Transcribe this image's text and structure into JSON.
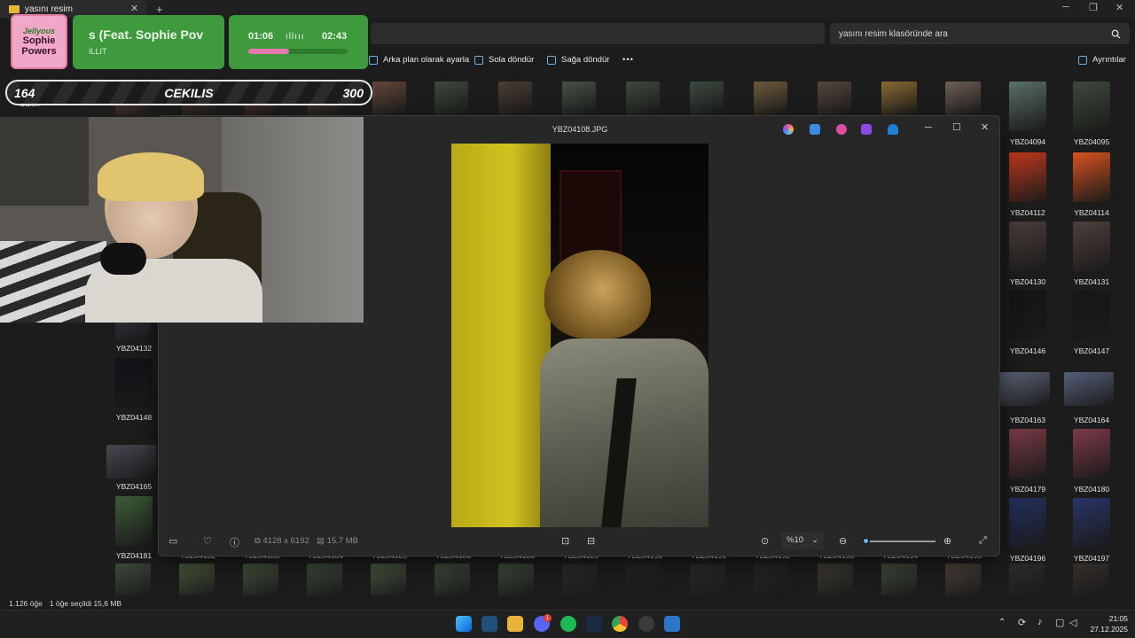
{
  "window": {
    "tab_title": "yasını resim",
    "new_tab": "+",
    "close_tab": "✕"
  },
  "search": {
    "placeholder": "yasını resim klasöründe ara"
  },
  "commands": {
    "set_background": "Arka plan olarak ayarla",
    "rotate_left": "Sola döndür",
    "rotate_right": "Sağa döndür",
    "more": "•••",
    "details": "Ayrıntılar"
  },
  "sidebar": {
    "gallery": "Galeri"
  },
  "files": {
    "right_col": [
      {
        "name": "YBZ04094",
        "color": "#5a6f6a"
      },
      {
        "name": "YBZ04095",
        "color": "#3c4a3a"
      },
      {
        "name": "YBZ04112",
        "color": "#c2391d"
      },
      {
        "name": "YBZ04114",
        "color": "#d8521f"
      },
      {
        "name": "YBZ04130",
        "color": "#4a3d3a"
      },
      {
        "name": "YBZ04131",
        "color": "#4d403c"
      },
      {
        "name": "YBZ04146",
        "color": "#141414"
      },
      {
        "name": "YBZ04147",
        "color": "#171717"
      },
      {
        "name": "YBZ04163",
        "color": "#5d6478"
      },
      {
        "name": "YBZ04164",
        "color": "#56607a"
      },
      {
        "name": "YBZ04179",
        "color": "#7a3b46"
      },
      {
        "name": "YBZ04180",
        "color": "#7e3a48"
      },
      {
        "name": "YBZ04196",
        "color": "#23305e"
      },
      {
        "name": "YBZ04197",
        "color": "#283566"
      }
    ],
    "left_col": [
      {
        "name": "YBZ04132",
        "color": "#2c2c36"
      },
      {
        "name": "YBZ04148",
        "color": "#121218"
      },
      {
        "name": "YBZ04165",
        "color": "#4a4650"
      },
      {
        "name": "YBZ04181",
        "color": "#3d5c38"
      }
    ],
    "bottom_row": [
      "YBZ04182",
      "YBZ04183",
      "YBZ04184",
      "YBZ04185",
      "YBZ04186",
      "YBZ04188",
      "YBZ04189",
      "YBZ04190",
      "YBZ04191",
      "YBZ04192",
      "YBZ04193",
      "YBZ04194",
      "YBZ04195"
    ]
  },
  "status": {
    "count": "1.126 öğe",
    "selected": "1 öğe seçildi  15,6 MB"
  },
  "viewer": {
    "filename": "YBZ04108.JPG",
    "dimensions": "4128 x 6192",
    "filesize": "15.7 MB",
    "zoom": "%10",
    "zoom_level": 0.02
  },
  "overlay": {
    "album_line1": "Jellyous",
    "album_line2": "Sophie",
    "album_line3": "Powers",
    "song": "s (Feat. Sophie Pov",
    "artist": "ILLIT",
    "time_current": "01:06",
    "time_total": "02:43",
    "progress": 0.41,
    "giveaway_left": "164",
    "giveaway_title": "CEKILIS",
    "giveaway_right": "300"
  },
  "taskbar": {
    "time": "21:05",
    "date": "27.12.2025",
    "badge": "1"
  },
  "colors": {
    "accent": "#6ab0e8",
    "green_panel": "#3e9a3d",
    "pink": "#f1a7c7"
  }
}
